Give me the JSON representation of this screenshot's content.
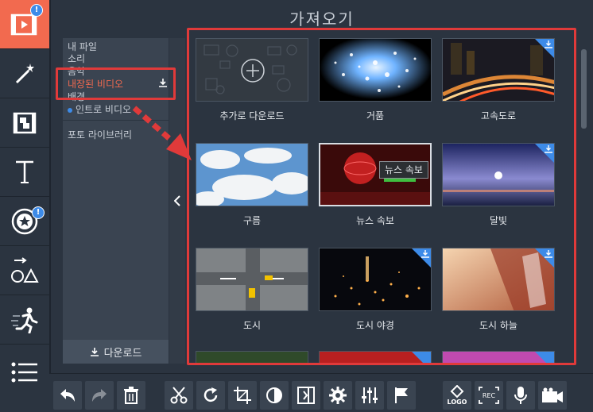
{
  "dialog": {
    "title": "가져오기"
  },
  "sidebar": {
    "badge_text": "!",
    "tools": [
      {
        "name": "import-icon"
      },
      {
        "name": "magic-wand-icon"
      },
      {
        "name": "transitions-icon"
      },
      {
        "name": "text-icon"
      },
      {
        "name": "stickers-icon"
      },
      {
        "name": "shapes-icon"
      },
      {
        "name": "motion-icon"
      },
      {
        "name": "list-icon"
      }
    ]
  },
  "categories": {
    "items": [
      "내 파일",
      "소리",
      "음악",
      "내장된 비디오",
      "배경",
      "인트로 비디오",
      "포토 라이브러리"
    ],
    "selected_index": 3,
    "download_label": "다운로드"
  },
  "grid": {
    "items": [
      {
        "label": "추가로 다운로드",
        "downloadable": false
      },
      {
        "label": "거품",
        "downloadable": false
      },
      {
        "label": "고속도로",
        "downloadable": true
      },
      {
        "label": "구름",
        "downloadable": false
      },
      {
        "label": "뉴스 속보",
        "downloadable": false
      },
      {
        "label": "달빛",
        "downloadable": true
      },
      {
        "label": "도시",
        "downloadable": false
      },
      {
        "label": "도시 야경",
        "downloadable": true
      },
      {
        "label": "도시 하늘",
        "downloadable": true
      }
    ],
    "tooltip": "뉴스 속보"
  },
  "toolbar": {
    "buttons": [
      "undo-icon",
      "redo-icon",
      "delete-icon",
      "cut-icon",
      "rotate-icon",
      "crop-icon",
      "color-icon",
      "split-icon",
      "settings-icon",
      "equalizer-icon",
      "flag-icon",
      "logo-icon",
      "record-screen-icon",
      "microphone-icon",
      "camera-icon"
    ],
    "logo_text": "LOGO",
    "rec_text": "REC"
  },
  "colors": {
    "accent": "#f26a4f",
    "panel_bg": "#2b3440",
    "highlight": "#e03a3a",
    "download_blue": "#3d8be8"
  }
}
